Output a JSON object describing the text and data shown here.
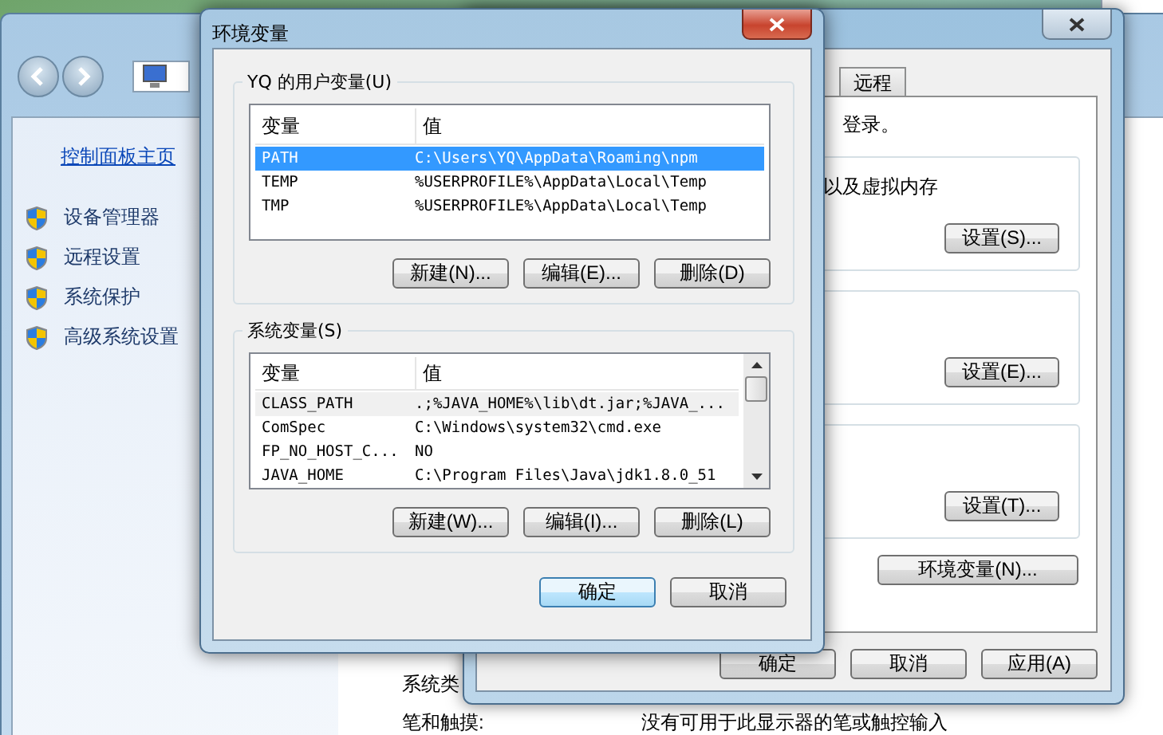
{
  "control_panel": {
    "home_link": "控制面板主页",
    "tasks": [
      {
        "label": "设备管理器"
      },
      {
        "label": "远程设置"
      },
      {
        "label": "系统保护"
      },
      {
        "label": "高级系统设置"
      }
    ],
    "details": [
      {
        "label": "系统类"
      },
      {
        "label": "笔和触摸:",
        "value": "没有可用于此显示器的笔或触控输入"
      }
    ]
  },
  "system_properties": {
    "tabs": [
      {
        "label": "远程",
        "selected": false
      }
    ],
    "intro": "登录。",
    "groups": [
      {
        "text": "以及虚拟内存",
        "button": "设置(S)..."
      },
      {
        "button": "设置(E)..."
      },
      {
        "button": "设置(T)..."
      }
    ],
    "env_button": "环境变量(N)...",
    "buttons": [
      {
        "label": "确定",
        "default": false
      },
      {
        "label": "取消",
        "default": false
      },
      {
        "label": "应用(A)",
        "default": false
      }
    ]
  },
  "env_dialog": {
    "title": "环境变量",
    "sections": [
      {
        "title": "YQ 的用户变量(U)",
        "focused": true,
        "scrollbar": false,
        "columns": [
          "变量",
          "值"
        ],
        "rows": [
          {
            "name": "PATH",
            "value": "C:\\Users\\YQ\\AppData\\Roaming\\npm",
            "selected": true
          },
          {
            "name": "TEMP",
            "value": "%USERPROFILE%\\AppData\\Local\\Temp",
            "selected": false
          },
          {
            "name": "TMP",
            "value": "%USERPROFILE%\\AppData\\Local\\Temp",
            "selected": false
          }
        ],
        "buttons": [
          "新建(N)...",
          "编辑(E)...",
          "删除(D)"
        ]
      },
      {
        "title": "系统变量(S)",
        "focused": false,
        "scrollbar": true,
        "columns": [
          "变量",
          "值"
        ],
        "rows": [
          {
            "name": "CLASS_PATH",
            "value": ".;%JAVA_HOME%\\lib\\dt.jar;%JAVA_...",
            "selected": true
          },
          {
            "name": "ComSpec",
            "value": "C:\\Windows\\system32\\cmd.exe",
            "selected": false
          },
          {
            "name": "FP_NO_HOST_C...",
            "value": "NO",
            "selected": false
          },
          {
            "name": "JAVA_HOME",
            "value": "C:\\Program Files\\Java\\jdk1.8.0_51",
            "selected": false
          }
        ],
        "buttons": [
          "新建(W)...",
          "编辑(I)...",
          "删除(L)"
        ]
      }
    ],
    "buttons": [
      {
        "label": "确定",
        "default": true
      },
      {
        "label": "取消",
        "default": false
      }
    ]
  }
}
